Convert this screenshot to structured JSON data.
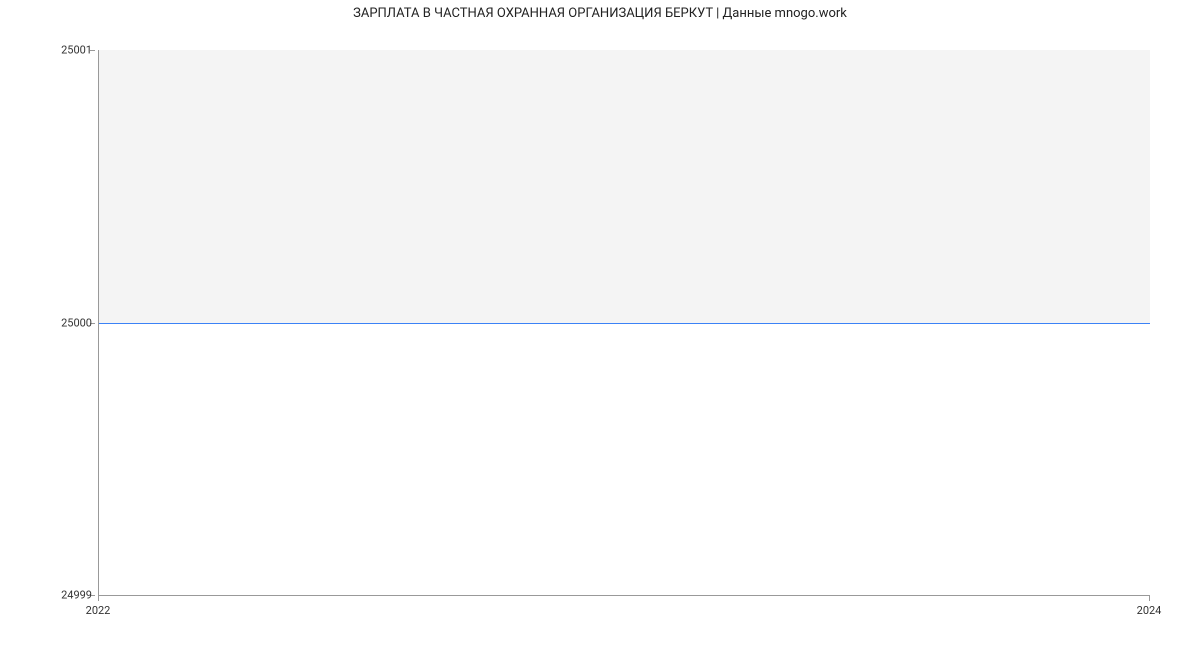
{
  "chart_data": {
    "type": "line",
    "title": "ЗАРПЛАТА В  ЧАСТНАЯ ОХРАННАЯ ОРГАНИЗАЦИЯ БЕРКУТ | Данные mnogo.work",
    "xlabel": "",
    "ylabel": "",
    "x": [
      2022,
      2024
    ],
    "y": [
      25000,
      25000
    ],
    "x_ticks": [
      "2022",
      "2024"
    ],
    "y_ticks": [
      "24999",
      "25000",
      "25001"
    ],
    "ylim": [
      24999,
      25001
    ],
    "xlim": [
      2022,
      2024
    ]
  }
}
